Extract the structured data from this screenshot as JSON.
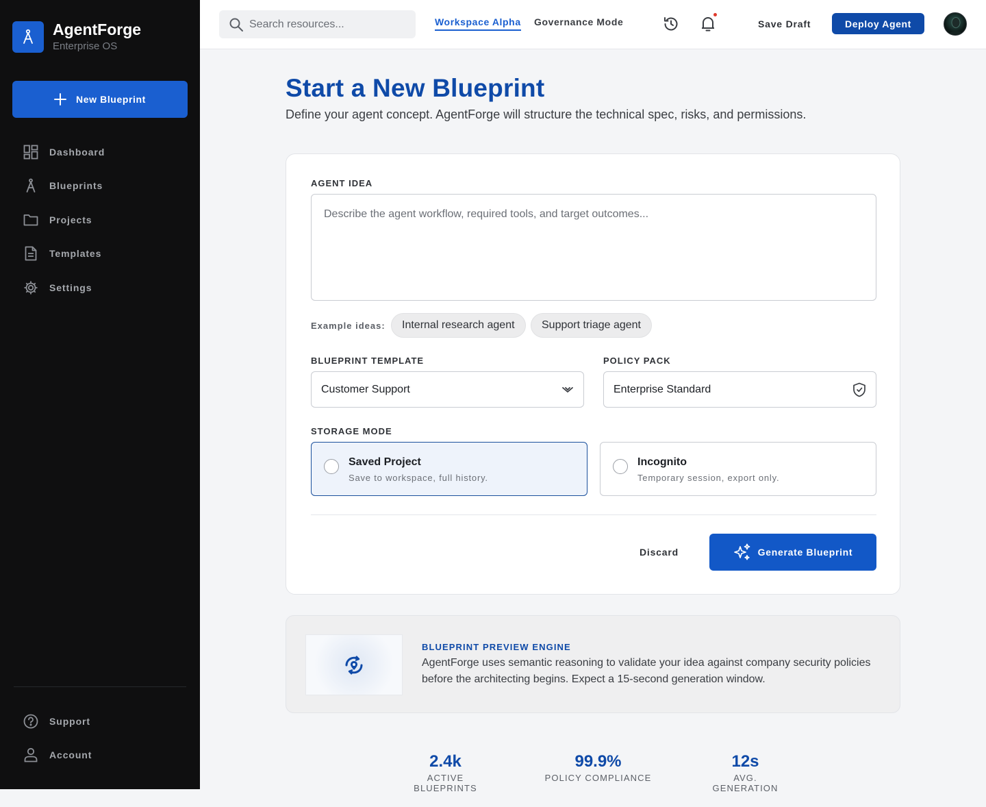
{
  "brand": {
    "name": "AgentForge",
    "subtitle": "Enterprise OS"
  },
  "sidebar": {
    "new_button": "New Blueprint",
    "items": [
      {
        "label": "Dashboard",
        "icon": "dashboard-grid-icon"
      },
      {
        "label": "Blueprints",
        "icon": "compass-icon"
      },
      {
        "label": "Projects",
        "icon": "folder-icon"
      },
      {
        "label": "Templates",
        "icon": "document-icon"
      },
      {
        "label": "Settings",
        "icon": "gear-icon"
      }
    ],
    "bottom_items": [
      {
        "label": "Support",
        "icon": "help-circle-icon"
      },
      {
        "label": "Account",
        "icon": "user-icon"
      }
    ]
  },
  "topbar": {
    "search_placeholder": "Search resources...",
    "tabs": [
      {
        "label": "Workspace Alpha",
        "active": true
      },
      {
        "label": "Governance Mode",
        "active": false
      }
    ],
    "save_draft": "Save Draft",
    "deploy": "Deploy Agent"
  },
  "page": {
    "title": "Start a New Blueprint",
    "subtitle": "Define your agent concept. AgentForge will structure the technical spec, risks, and permissions."
  },
  "form": {
    "idea_label": "AGENT IDEA",
    "idea_placeholder": "Describe the agent workflow, required tools, and target outcomes...",
    "examples_label": "Example ideas:",
    "examples": [
      "Internal research agent",
      "Support triage agent"
    ],
    "template_label": "BLUEPRINT TEMPLATE",
    "template_value": "Customer Support",
    "policy_label": "POLICY PACK",
    "policy_value": "Enterprise Standard",
    "storage_label": "STORAGE MODE",
    "storage_options": [
      {
        "title": "Saved Project",
        "desc": "Save to workspace, full history.",
        "selected": true
      },
      {
        "title": "Incognito",
        "desc": "Temporary session, export only.",
        "selected": false
      }
    ],
    "discard": "Discard",
    "generate": "Generate Blueprint"
  },
  "info": {
    "title": "BLUEPRINT PREVIEW ENGINE",
    "body": "AgentForge uses semantic reasoning to validate your idea against company security policies before the architecting begins. Expect a 15-second generation window."
  },
  "stats": [
    {
      "value": "2.4k",
      "label": "ACTIVE BLUEPRINTS"
    },
    {
      "value": "99.9%",
      "label": "POLICY COMPLIANCE"
    },
    {
      "value": "12s",
      "label": "AVG. GENERATION"
    }
  ],
  "colors": {
    "accent": "#1a5fd0",
    "brand_dark": "#0f4aa8",
    "sidebar_bg": "#0f0f10",
    "notification_dot": "#e03a2c"
  }
}
